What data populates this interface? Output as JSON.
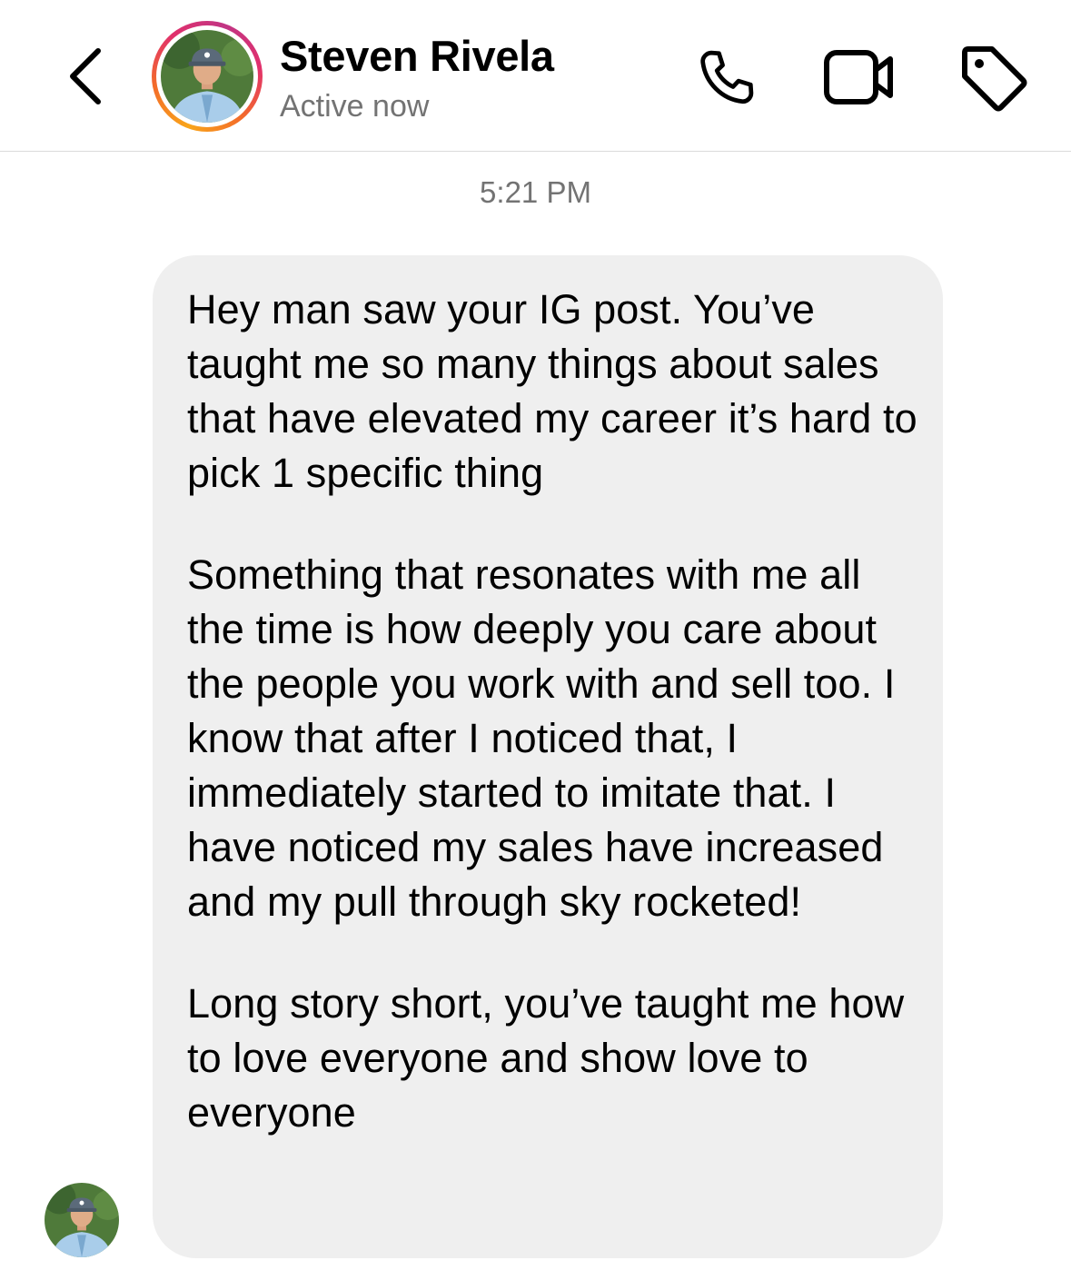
{
  "header": {
    "contact_name": "Steven Rivela",
    "status": "Active now",
    "icons": {
      "back": "chevron-left-icon",
      "call": "phone-icon",
      "video": "video-camera-icon",
      "tag": "tag-icon"
    },
    "story_ring_colors": [
      "#f9a51a",
      "#f36b2a",
      "#e1306c",
      "#c13584"
    ]
  },
  "thread": {
    "timestamp": "5:21 PM",
    "messages": [
      {
        "sender": "Steven Rivela",
        "paragraphs": [
          "Hey man saw your IG post. You’ve taught me so many things about sales that have elevated my career it’s hard to pick 1 specific thing",
          "Something that resonates with me all the time is how deeply you care about the people you work with and sell too. I know that after I noticed that, I immediately started to imitate that. I have noticed my sales have increased and my pull through sky rocketed!",
          "Long story short, you’ve taught me how to love everyone and show love to everyone"
        ]
      }
    ]
  },
  "colors": {
    "bubble_background": "#efefef",
    "secondary_text": "#737373",
    "divider": "#dbdbdb"
  }
}
